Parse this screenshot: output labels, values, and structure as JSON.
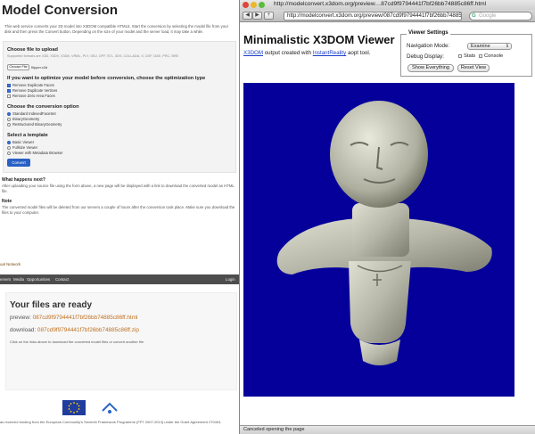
{
  "left": {
    "title": "Model Conversion",
    "description": "This web service converts your 3D model into X3DOM compatible HTML5. Start the conversion by selecting the model file from your disk and then press the Convert button. Depending on the size of your model and the server load, it may take a while.",
    "upload": {
      "heading": "Choose file to upload",
      "supported": "Supported formats are X3D, X3DV, X3DB, VRML, PLY, OBJ, OFF, STL, 3DS, COLLADA, X, DXF, DAE, PRC, BRE",
      "file_button": "Choose File",
      "file_name": "flipper.x3d"
    },
    "optimization": {
      "heading": "If you want to optimize your model before conversion, choose the optimization type",
      "options": [
        {
          "label": "Remove Duplicate Faces",
          "checked": true
        },
        {
          "label": "Remove Duplicate Vertices",
          "checked": true
        },
        {
          "label": "Remove Zero Area Faces",
          "checked": false
        }
      ]
    },
    "conversion": {
      "heading": "Choose the conversion option",
      "options": [
        {
          "label": "Standard IndexedFaceSet",
          "selected": true
        },
        {
          "label": "BinaryGeometry",
          "selected": false
        },
        {
          "label": "Restructured BinaryGeometry",
          "selected": false
        }
      ]
    },
    "template": {
      "heading": "Select a template",
      "options": [
        {
          "label": "Basic Viewer",
          "selected": true
        },
        {
          "label": "Fullsize Viewer",
          "selected": false
        },
        {
          "label": "Viewer with Metadata Browser",
          "selected": false
        }
      ]
    },
    "convert_button": "Convert",
    "what_heading": "What happens next?",
    "what_text": "After uploading your source file using the form above, a new page will be displayed with a link to download the converted model as HTML file.",
    "note_heading": "Note",
    "note_text": "The converted model files will be deleted from our servers a couple of hours after the conversion took place. Make sure you download the files to your computer.",
    "network_text": "ual Network",
    "nav": [
      "ervers",
      "Media",
      "Opportunities",
      "Contact"
    ],
    "login": "Login",
    "ready": {
      "title": "Your files are ready",
      "preview_label": "preview:",
      "preview_link": "087cd9f9794441f7bf26bb74885c86ff.html",
      "download_label": "download:",
      "download_link": "087cd9f9794441f7bf26bb74885c86ff.zip",
      "note": "Click on the links above to download the converted model files or convert another file"
    },
    "funding": "as received funding from the European Community's Seventh Framework Programme (FP7 2007-2013) under the Grant Agreement 270404."
  },
  "browser": {
    "window_title": "http://modelconvert.x3dom.org/preview…87cd9f9794441f7bf26bb74885c86ff.html",
    "url": "http://modelconvert.x3dom.org/preview/087cd9f9794441f7bf26bb74885c86ff.html",
    "search_placeholder": "Google",
    "status": "Canceled opening the page"
  },
  "viewer": {
    "title": "Minimalistic X3DOM Viewer",
    "desc_link1": "X3DOM",
    "desc_mid": " output created with ",
    "desc_link2": "InstantReality",
    "desc_end": " aopt tool.",
    "settings": {
      "legend": "Viewer Settings",
      "nav_label": "Navigation Mode:",
      "nav_value": "Examine",
      "debug_label": "Debug Display:",
      "stats_label": "Stats",
      "console_label": "Console",
      "show_button": "Show Everything",
      "reset_button": "Reset View"
    },
    "background_color": "#05009a"
  }
}
